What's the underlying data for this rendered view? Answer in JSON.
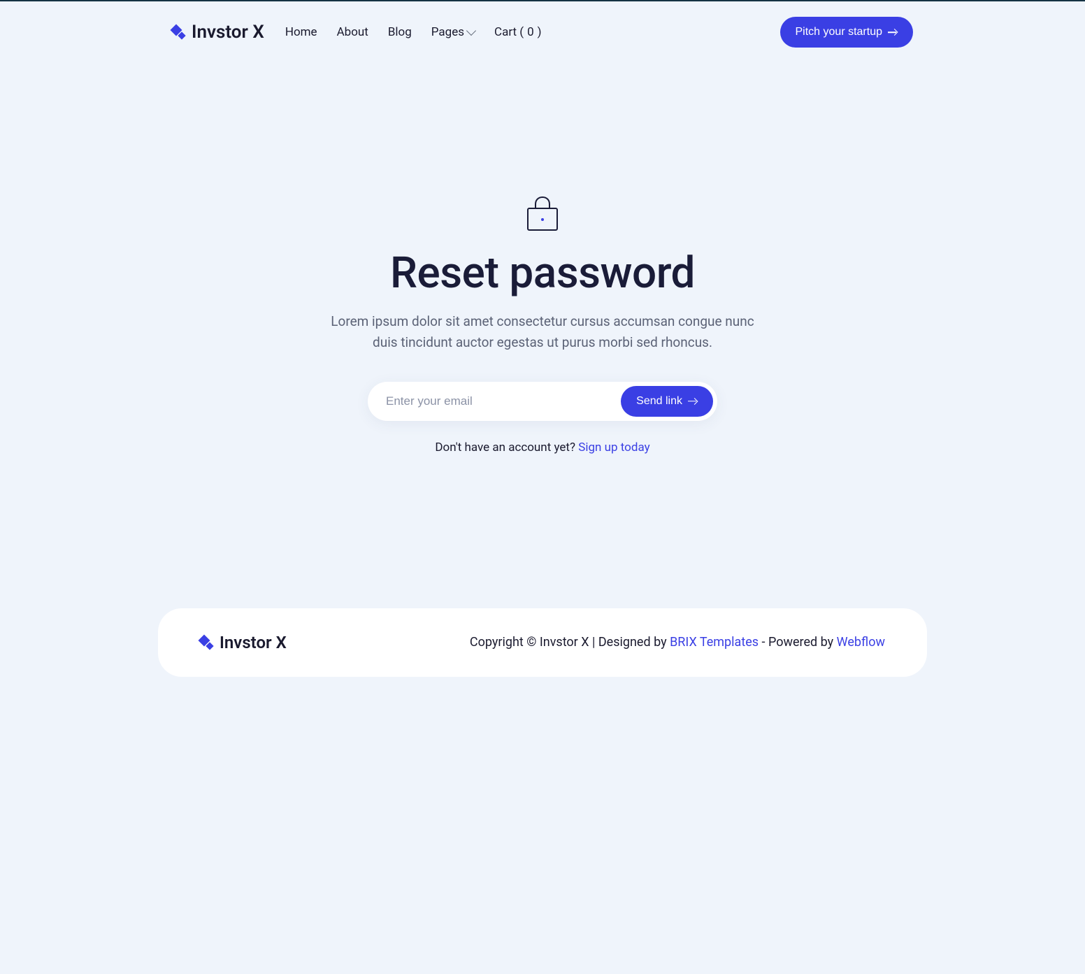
{
  "brand": {
    "name": "Invstor X"
  },
  "nav": {
    "home": "Home",
    "about": "About",
    "blog": "Blog",
    "pages": "Pages",
    "cart_prefix": "Cart (",
    "cart_count": "0",
    "cart_suffix": ")"
  },
  "cta": {
    "label": "Pitch your startup"
  },
  "main": {
    "title": "Reset password",
    "subtitle": "Lorem ipsum dolor sit amet consectetur cursus accumsan congue nunc duis tincidunt auctor egestas ut purus morbi sed rhoncus.",
    "email_placeholder": "Enter your email",
    "send_label": "Send link",
    "no_account": "Don't have an account yet? ",
    "signup": "Sign up today"
  },
  "footer": {
    "copyright": "Copyright © Invstor X | Designed by ",
    "brix": "BRIX Templates",
    "powered": " - Powered by ",
    "webflow": "Webflow"
  }
}
